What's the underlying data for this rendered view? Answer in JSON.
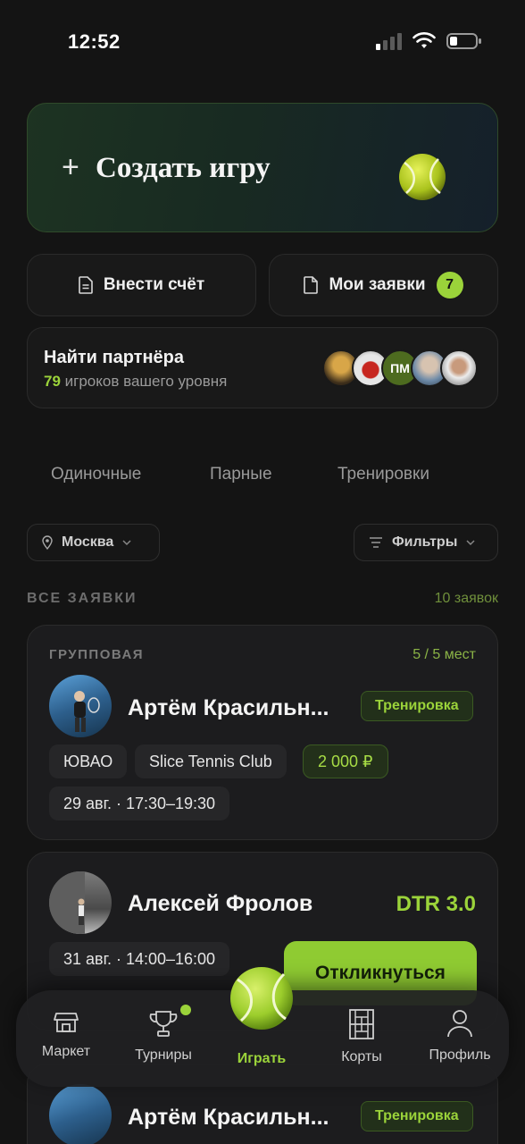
{
  "status_bar": {
    "time": "12:52"
  },
  "create_card": {
    "label": "Создать игру",
    "plus": "+"
  },
  "actions": {
    "submit_score": "Внести счёт",
    "my_requests": "Мои заявки",
    "my_requests_count": "7"
  },
  "partner": {
    "title": "Найти партнёра",
    "count": "79",
    "subtitle": "игроков вашего уровня",
    "avatar_initials": "ПМ"
  },
  "tabs": [
    "Одиночные",
    "Парные",
    "Тренировки"
  ],
  "filters": {
    "city": "Москва",
    "filters_label": "Фильтры"
  },
  "section": {
    "title": "ВСЕ ЗАЯВКИ",
    "count": "10 заявок"
  },
  "listings": [
    {
      "type": "ГРУППОВАЯ",
      "slots": "5 / 5 мест",
      "name": "Артём Красильн...",
      "tag": "Тренировка",
      "district": "ЮВАО",
      "club": "Slice Tennis Club",
      "price": "2 000 ₽",
      "datetime": "29 авг. · 17:30–19:30"
    },
    {
      "name": "Алексей Фролов",
      "dtr": "DTR 3.0",
      "datetime": "31 авг. · 14:00–16:00",
      "action": "Откликнуться"
    },
    {
      "name": "Артём Красильн...",
      "tag": "Тренировка"
    }
  ],
  "nav": {
    "market": "Маркет",
    "tournaments": "Турниры",
    "play": "Играть",
    "courts": "Корты",
    "profile": "Профиль"
  },
  "colors": {
    "accent": "#9bd33a",
    "background": "#141414",
    "card": "#1c1c1e"
  },
  "icons": [
    "signal-icon",
    "wifi-icon",
    "battery-icon",
    "plus-icon",
    "tennis-ball-icon",
    "document-icon",
    "location-pin-icon",
    "filter-icon",
    "chevron-down-icon",
    "store-icon",
    "trophy-icon",
    "court-icon",
    "user-icon"
  ]
}
